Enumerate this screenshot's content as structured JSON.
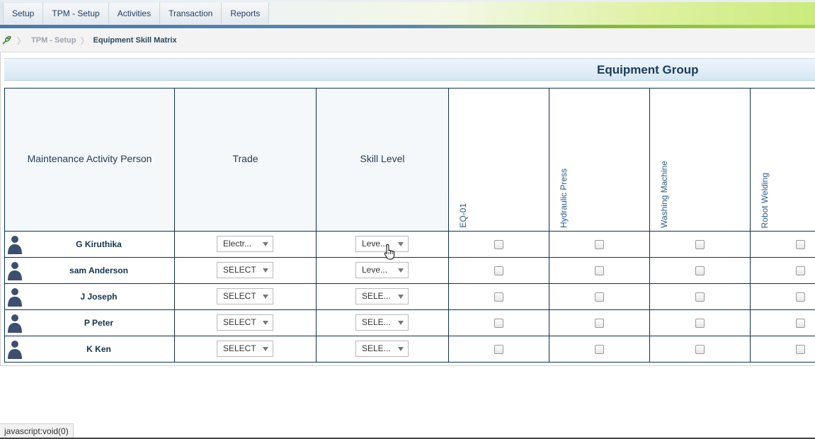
{
  "menu": {
    "items": [
      {
        "label": "Setup"
      },
      {
        "label": "TPM - Setup"
      },
      {
        "label": "Activities"
      },
      {
        "label": "Transaction"
      },
      {
        "label": "Reports"
      }
    ]
  },
  "breadcrumb": {
    "home_icon": "home-icon",
    "parent": "TPM - Setup",
    "current": "Equipment Skill Matrix"
  },
  "group_title": "Equipment Group",
  "table": {
    "headers": {
      "person": "Maintenance Activity Person",
      "trade": "Trade",
      "skill": "Skill Level"
    },
    "equipment": [
      "EQ-01",
      "Hydraulic Press",
      "Washing Machine",
      "Robot Welding"
    ],
    "rows": [
      {
        "name": "G Kiruthika",
        "trade": "Electr...",
        "skill": "Leve...",
        "checks": [
          false,
          false,
          false,
          false
        ]
      },
      {
        "name": "sam Anderson",
        "trade": "SELECT",
        "skill": "Leve...",
        "checks": [
          false,
          false,
          false,
          false
        ]
      },
      {
        "name": "J Joseph",
        "trade": "SELECT",
        "skill": "SELE...",
        "checks": [
          false,
          false,
          false,
          false
        ]
      },
      {
        "name": "P Peter",
        "trade": "SELECT",
        "skill": "SELE...",
        "checks": [
          false,
          false,
          false,
          false
        ]
      },
      {
        "name": "K Ken",
        "trade": "SELECT",
        "skill": "SELE...",
        "checks": [
          false,
          false,
          false,
          false
        ]
      }
    ]
  },
  "status_bar": "javascript:void(0)",
  "colors": {
    "table_border": "#0d3156",
    "header_text": "#1b3b5c",
    "menu_accent": "#a7d34e"
  }
}
